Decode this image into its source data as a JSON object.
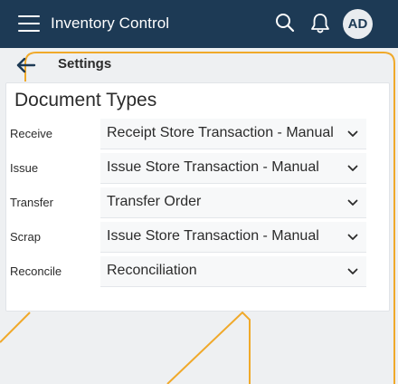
{
  "header": {
    "app_title": "Inventory Control",
    "avatar_initials": "AD",
    "brand_color": "#1d3a55",
    "icons": [
      "menu-icon",
      "search-icon",
      "bell-icon"
    ]
  },
  "subheader": {
    "title": "Settings"
  },
  "card": {
    "title": "Document Types",
    "rows": [
      {
        "label": "Receive",
        "value": "Receipt Store Transaction - Manual"
      },
      {
        "label": "Issue",
        "value": "Issue Store Transaction - Manual"
      },
      {
        "label": "Transfer",
        "value": "Transfer Order"
      },
      {
        "label": "Scrap",
        "value": "Issue Store Transaction - Manual"
      },
      {
        "label": "Reconcile",
        "value": "Reconciliation"
      }
    ]
  },
  "accent_color": "#f0a92a"
}
